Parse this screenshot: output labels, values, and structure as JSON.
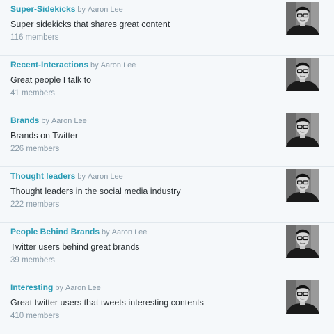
{
  "lists": [
    {
      "name": "Super-Sidekicks",
      "by": "by",
      "owner": "Aaron Lee",
      "description": "Super sidekicks that shares great content",
      "members": "116 members"
    },
    {
      "name": "Recent-Interactions",
      "by": "by",
      "owner": "Aaron Lee",
      "description": "Great people I talk to",
      "members": "41 members"
    },
    {
      "name": "Brands",
      "by": "by",
      "owner": "Aaron Lee",
      "description": "Brands on Twitter",
      "members": "226 members"
    },
    {
      "name": "Thought leaders",
      "by": "by",
      "owner": "Aaron Lee",
      "description": "Thought leaders in the social media industry",
      "members": "222 members"
    },
    {
      "name": "People Behind Brands",
      "by": "by",
      "owner": "Aaron Lee",
      "description": "Twitter users behind great brands",
      "members": "39 members"
    },
    {
      "name": "Interesting",
      "by": "by",
      "owner": "Aaron Lee",
      "description": "Great twitter users that tweets interesting contents",
      "members": "410 members"
    }
  ],
  "icons": {
    "avatar": "owner-avatar-photo"
  },
  "colors": {
    "link": "#2b9cb5",
    "muted": "#8899a6",
    "text": "#292f33",
    "background": "#f5f8fa",
    "divider": "#e1e8ed"
  }
}
